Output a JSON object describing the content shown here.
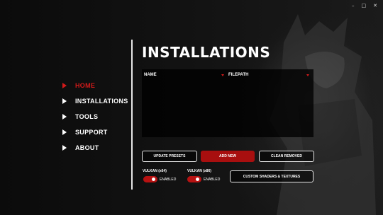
{
  "window": {
    "minimize": "–",
    "maximize": "□",
    "close": "✕"
  },
  "nav": {
    "items": [
      {
        "label": "HOME",
        "active": true
      },
      {
        "label": "INSTALLATIONS",
        "active": false
      },
      {
        "label": "TOOLS",
        "active": false
      },
      {
        "label": "SUPPORT",
        "active": false
      },
      {
        "label": "ABOUT",
        "active": false
      }
    ]
  },
  "main": {
    "title": "INSTALLATIONS",
    "table": {
      "columns": [
        "NAME",
        "FILEPATH"
      ],
      "rows": []
    },
    "buttons": {
      "update_presets": "UPDATE PRESETS",
      "add_new": "ADD NEW",
      "clean_removed": "CLEAN REMOVED",
      "custom_shaders": "CUSTOM SHADERS & TEXTURES"
    },
    "vulkan": [
      {
        "label": "VULKAN (x64)",
        "state": "ENABLED",
        "on": true
      },
      {
        "label": "VULKAN (x86)",
        "state": "ENABLED",
        "on": true
      }
    ]
  },
  "colors": {
    "accent": "#d11a1a",
    "button_red": "#a80f0f",
    "bg": "#0c0c0c"
  },
  "icons": {
    "nav_marker": "play-triangle-icon",
    "sort": "sort-caret-icon"
  }
}
